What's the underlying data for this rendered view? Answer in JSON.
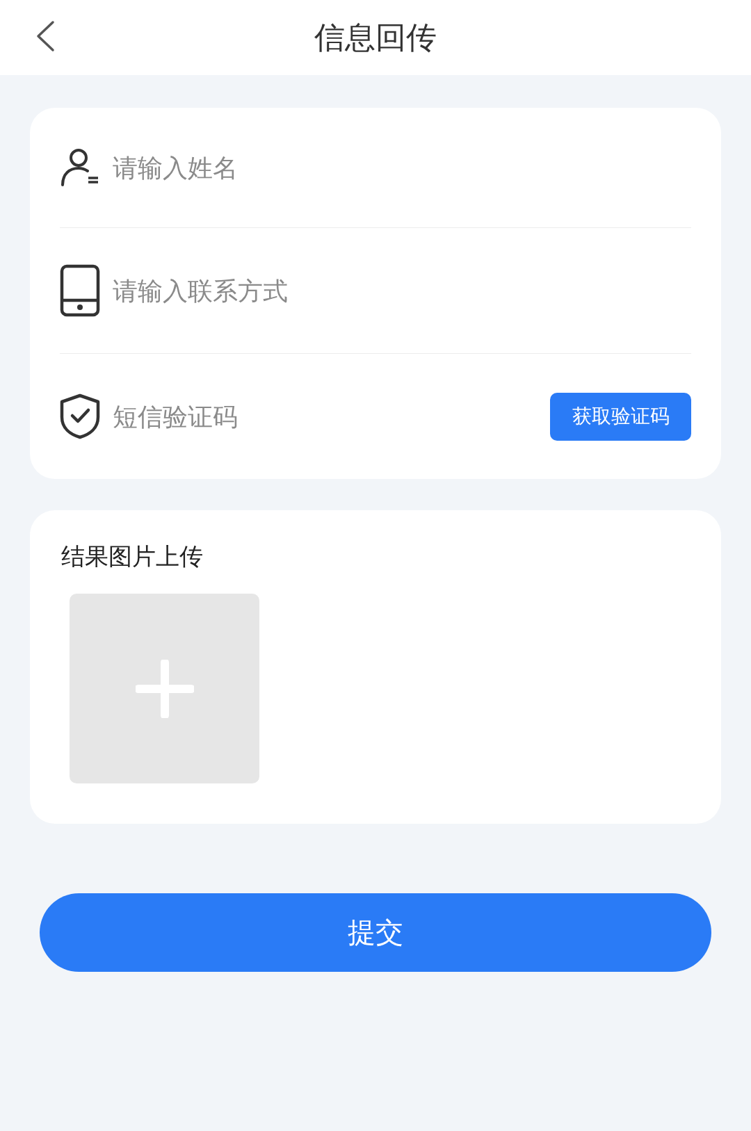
{
  "header": {
    "title": "信息回传"
  },
  "form": {
    "fields": [
      {
        "kind": "name",
        "placeholder": "请输入姓名"
      },
      {
        "kind": "phone",
        "placeholder": "请输入联系方式"
      },
      {
        "kind": "code",
        "placeholder": "短信验证码",
        "button": "获取验证码"
      }
    ]
  },
  "upload": {
    "title": "结果图片上传"
  },
  "submit": {
    "label": "提交"
  }
}
